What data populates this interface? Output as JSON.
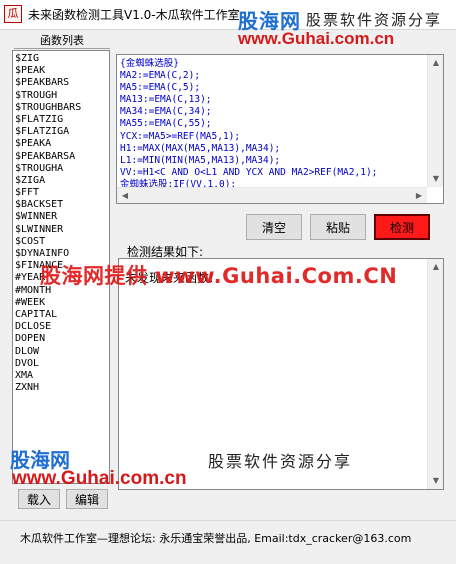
{
  "window": {
    "title": "未来函数检测工具V1.0-木瓜软件工作室",
    "icon_glyph": "瓜"
  },
  "function_list": {
    "header": "函数列表",
    "items": [
      "$ZIG",
      "$PEAK",
      "$PEAKBARS",
      "$TROUGH",
      "$TROUGHBARS",
      "$FLATZIG",
      "$FLATZIGA",
      "$PEAKA",
      "$PEAKBARSA",
      "$TROUGHA",
      "$ZIGA",
      "$FFT",
      "$BACKSET",
      "$WINNER",
      "$LWINNER",
      "$COST",
      "$DYNAINFO",
      "$FINANCE",
      "#YEAR",
      "#MONTH",
      "#WEEK",
      "CAPITAL",
      "DCLOSE",
      "DOPEN",
      "DLOW",
      "DVOL",
      "XMA",
      "ZXNH"
    ]
  },
  "editor": {
    "lines": [
      "{金蜘蛛选股}",
      "MA2:=EMA(C,2);",
      "MA5:=EMA(C,5);",
      "MA13:=EMA(C,13);",
      "MA34:=EMA(C,34);",
      "MA55:=EMA(C,55);",
      "YCX:=MA5>=REF(MA5,1);",
      "H1:=MAX(MAX(MA5,MA13),MA34);",
      "L1:=MIN(MIN(MA5,MA13),MA34);",
      "VV:=H1<C AND O<L1 AND YCX AND MA2>REF(MA2,1);",
      "金蜘蛛选股:IF(VV,1,0);"
    ]
  },
  "buttons": {
    "clear": "清空",
    "paste": "粘贴",
    "detect": "检测",
    "load": "载入",
    "edit": "编辑"
  },
  "results": {
    "label": "检测结果如下:",
    "text": "未发现未来函数!"
  },
  "status": {
    "text": "木瓜软件工作室—理想论坛: 永乐通宝荣誉出品, Email:tdx_cracker@163.com"
  },
  "watermark": {
    "top_name": "股海网",
    "top_slogan": "股票软件资源分享",
    "top_url": "www.Guhai.com.cn",
    "center": "股海网提供 www.Guhai.Com.CN",
    "bottom_name": "股海网",
    "bottom_slogan": "股票软件资源分享",
    "bottom_url": "www.Guhai.com.cn"
  },
  "colors": {
    "detect_button_bg": "#ff1a1a",
    "editor_text": "#0000cc",
    "watermark_red": "#e01818",
    "watermark_blue": "#1f6fd1"
  }
}
